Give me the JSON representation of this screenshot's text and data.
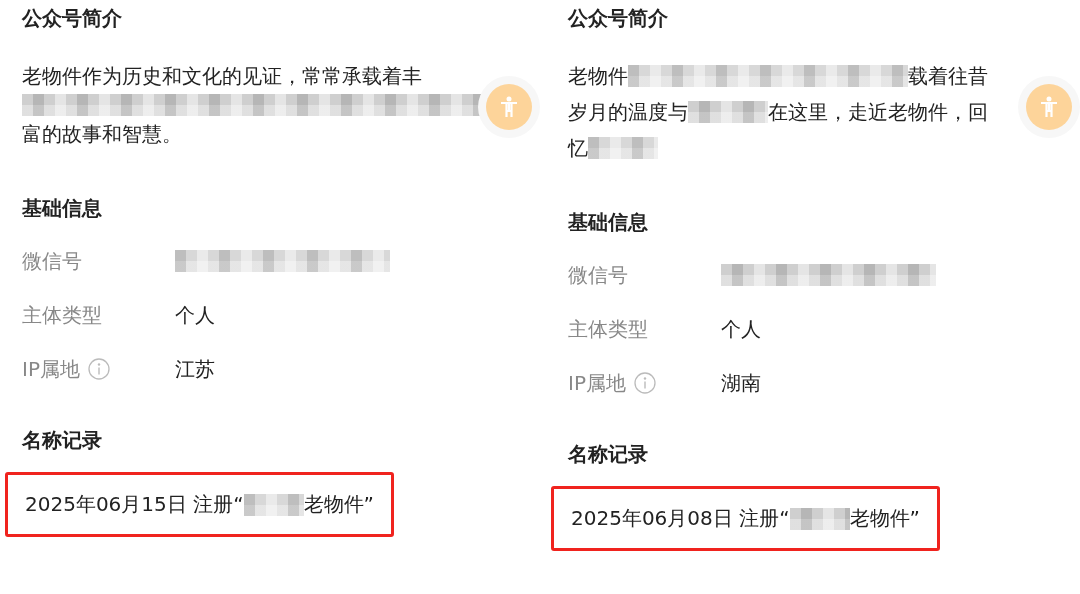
{
  "panels": [
    {
      "intro_title": "公众号简介",
      "intro_lines": [
        [
          {
            "kind": "text",
            "text": "老物件作为历史和文化的见证，常常承载着丰"
          }
        ],
        [
          {
            "kind": "mosaic"
          }
        ],
        [
          {
            "kind": "text",
            "text": "富的故事和智慧。"
          }
        ]
      ],
      "basic_title": "基础信息",
      "fields": [
        {
          "label": "微信号",
          "info_icon": false,
          "value": [
            {
              "kind": "mosaic"
            }
          ]
        },
        {
          "label": "主体类型",
          "info_icon": false,
          "value": [
            {
              "kind": "text",
              "text": "个人"
            }
          ]
        },
        {
          "label": "IP属地",
          "info_icon": true,
          "value": [
            {
              "kind": "text",
              "text": "江苏"
            }
          ]
        }
      ],
      "records_title": "名称记录",
      "records": [
        {
          "highlighted": true,
          "parts": [
            {
              "kind": "text",
              "text": "2025年06月15日 注册“"
            },
            {
              "kind": "mosaic"
            },
            {
              "kind": "text",
              "text": "老物件”"
            }
          ]
        }
      ]
    },
    {
      "intro_title": "公众号简介",
      "intro_lines": [
        [
          {
            "kind": "text",
            "text": "老物件"
          },
          {
            "kind": "mosaic"
          },
          {
            "kind": "text",
            "text": "载着往昔"
          }
        ],
        [
          {
            "kind": "text",
            "text": "岁月的温度与"
          },
          {
            "kind": "mosaic"
          },
          {
            "kind": "text",
            "text": "在这里，走近老物件，回"
          }
        ],
        [
          {
            "kind": "text",
            "text": "忆"
          },
          {
            "kind": "mosaic"
          }
        ]
      ],
      "basic_title": "基础信息",
      "fields": [
        {
          "label": "微信号",
          "info_icon": false,
          "value": [
            {
              "kind": "mosaic"
            }
          ]
        },
        {
          "label": "主体类型",
          "info_icon": false,
          "value": [
            {
              "kind": "text",
              "text": "个人"
            }
          ]
        },
        {
          "label": "IP属地",
          "info_icon": true,
          "value": [
            {
              "kind": "text",
              "text": "湖南"
            }
          ]
        }
      ],
      "records_title": "名称记录",
      "records": [
        {
          "highlighted": true,
          "parts": [
            {
              "kind": "text",
              "text": "2025年06月08日 注册“"
            },
            {
              "kind": "mosaic"
            },
            {
              "kind": "text",
              "text": "老物件”"
            }
          ]
        }
      ]
    }
  ]
}
